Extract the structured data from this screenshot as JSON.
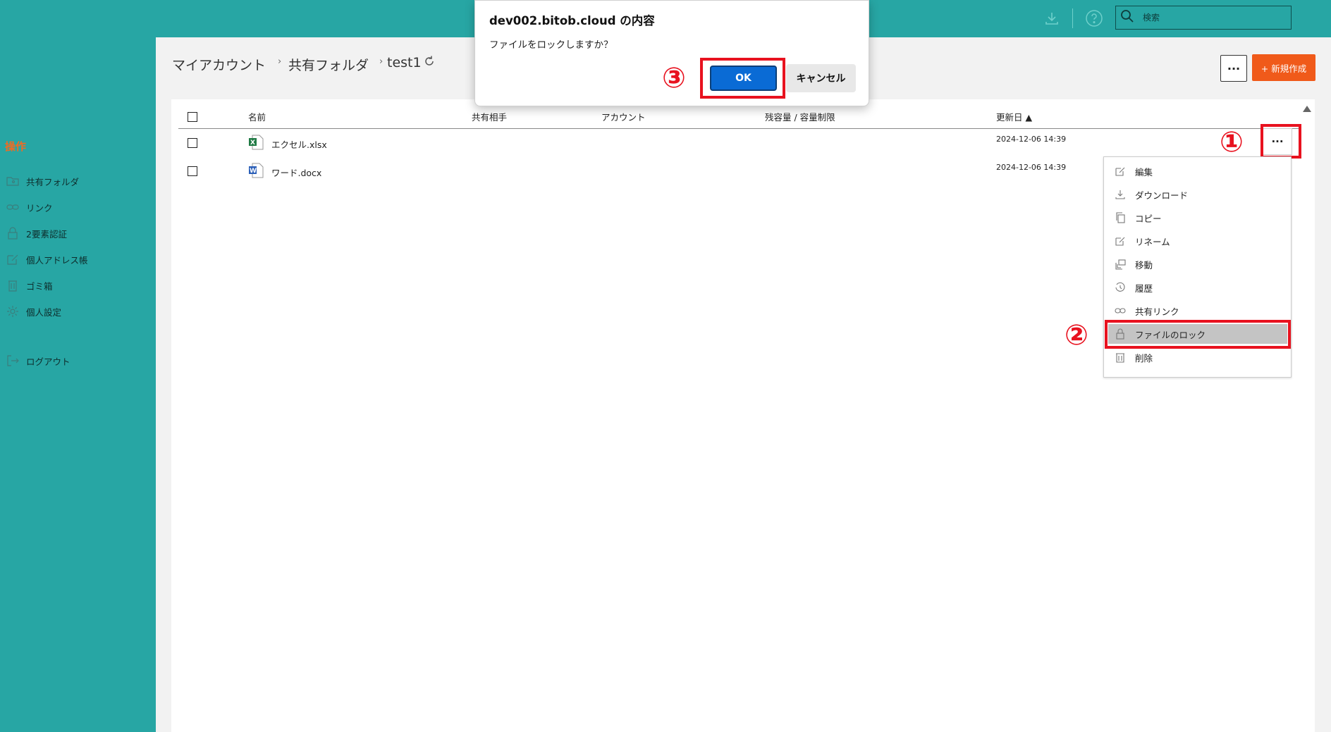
{
  "topbar": {
    "search_placeholder": "検索",
    "icons": [
      "download-icon",
      "help-icon",
      "search-icon"
    ]
  },
  "sidebar": {
    "section_label": "操作",
    "items": [
      {
        "label": "共有フォルダ",
        "icon": "shared-folder-icon"
      },
      {
        "label": "リンク",
        "icon": "link-icon"
      },
      {
        "label": "2要素認証",
        "icon": "lock-icon"
      },
      {
        "label": "個人アドレス帳",
        "icon": "edit-icon"
      },
      {
        "label": "ゴミ箱",
        "icon": "trash-icon"
      },
      {
        "label": "個人設定",
        "icon": "gear-icon"
      },
      {
        "label": "ログアウト",
        "icon": "logout-icon"
      }
    ]
  },
  "breadcrumb": {
    "items": [
      "マイアカウント",
      "共有フォルダ",
      "test1"
    ]
  },
  "toolbar": {
    "more_label": "···",
    "new_label": "+ 新規作成"
  },
  "table": {
    "headers": [
      "名前",
      "共有相手",
      "アカウント",
      "残容量 / 容量制限",
      "更新日 ▲"
    ],
    "rows": [
      {
        "name": "エクセル.xlsx",
        "date": "2024-12-06 14:39",
        "type": "excel"
      },
      {
        "name": "ワード.docx",
        "date": "2024-12-06 14:39",
        "type": "word"
      }
    ],
    "row_more_label": "···"
  },
  "context_menu": {
    "items": [
      {
        "label": "編集",
        "icon": "edit-icon"
      },
      {
        "label": "ダウンロード",
        "icon": "download-icon"
      },
      {
        "label": "コピー",
        "icon": "copy-icon"
      },
      {
        "label": "リネーム",
        "icon": "rename-icon"
      },
      {
        "label": "移動",
        "icon": "move-icon"
      },
      {
        "label": "履歴",
        "icon": "history-icon"
      },
      {
        "label": "共有リンク",
        "icon": "link-icon"
      },
      {
        "label": "ファイルのロック",
        "icon": "lock-icon"
      },
      {
        "label": "削除",
        "icon": "trash-icon"
      }
    ],
    "active_index": 7
  },
  "dialog": {
    "title": "dev002.bitob.cloud の内容",
    "message": "ファイルをロックしますか？",
    "ok_label": "OK",
    "cancel_label": "キャンセル"
  },
  "annotations": {
    "step1": "①",
    "step2": "②",
    "step3": "③"
  },
  "colors": {
    "teal": "#27a6a4",
    "accent_orange": "#f05a1a",
    "annotation_red": "#e8121f",
    "ok_blue": "#0a6bd5"
  }
}
